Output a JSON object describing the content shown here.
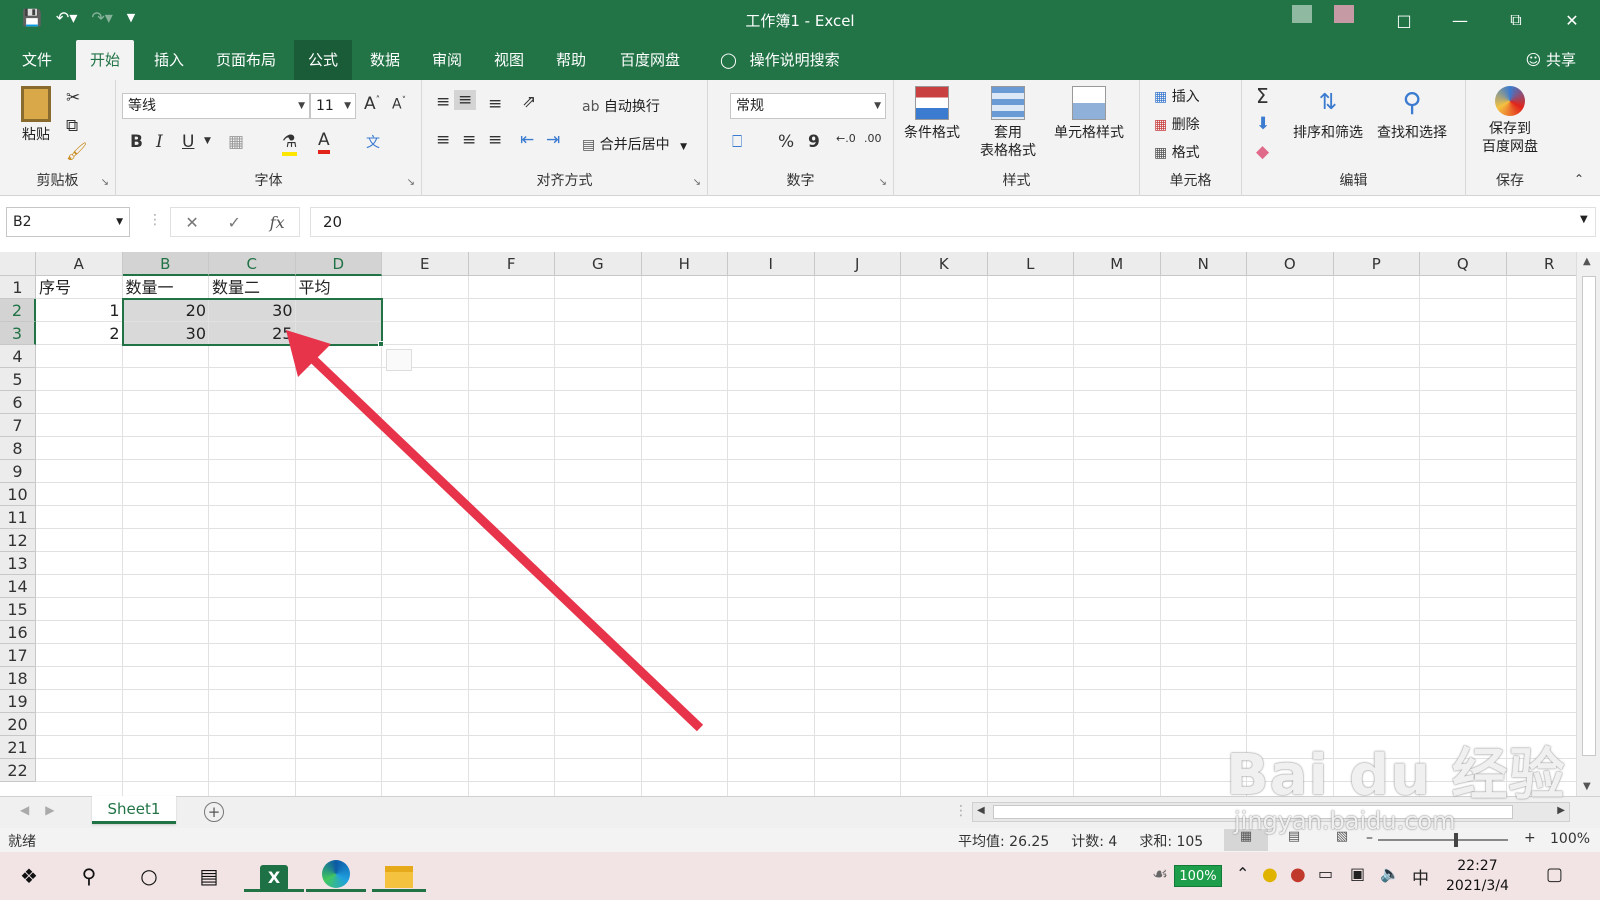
{
  "titlebar": {
    "title": "工作簿1  -  Excel",
    "qat_icons": [
      "save-icon",
      "undo-icon",
      "redo-icon",
      "customize-icon"
    ],
    "window_controls": [
      "ribbon-display-icon",
      "minimize-icon",
      "restore-icon",
      "close-icon"
    ],
    "colors": {
      "bar": "#227447"
    }
  },
  "tabs": {
    "items": [
      "文件",
      "开始",
      "插入",
      "页面布局",
      "公式",
      "数据",
      "审阅",
      "视图",
      "帮助",
      "百度网盘"
    ],
    "active": "开始",
    "tell_me": "操作说明搜索",
    "share": "共享"
  },
  "ribbon": {
    "clipboard": {
      "paste": "粘贴",
      "label": "剪贴板"
    },
    "font": {
      "name": "等线",
      "size": "11",
      "label": "字体",
      "bold": "B",
      "italic": "I",
      "underline": "U"
    },
    "alignment": {
      "wrap": "自动换行",
      "merge": "合并后居中",
      "label": "对齐方式"
    },
    "number": {
      "format": "常规",
      "percent": "%",
      "comma": "9",
      "label": "数字"
    },
    "styles": {
      "conditional": "条件格式",
      "table1": "套用",
      "table2": "表格格式",
      "cell_styles": "单元格样式",
      "label": "样式"
    },
    "cells": {
      "insert": "插入",
      "delete": "删除",
      "format": "格式",
      "label": "单元格"
    },
    "editing": {
      "sort": "排序和筛选",
      "find": "查找和选择",
      "label": "编辑"
    },
    "save": {
      "line1": "保存到",
      "line2": "百度网盘",
      "label": "保存"
    }
  },
  "formula_bar": {
    "name_box": "B2",
    "fx": "fx",
    "value": "20"
  },
  "grid": {
    "columns": [
      "A",
      "B",
      "C",
      "D",
      "E",
      "F",
      "G",
      "H",
      "I",
      "J",
      "K",
      "L",
      "M",
      "N",
      "O",
      "P",
      "Q",
      "R"
    ],
    "rows": [
      "1",
      "2",
      "3",
      "4",
      "5",
      "6",
      "7",
      "8",
      "9",
      "10",
      "11",
      "12",
      "13",
      "14",
      "15",
      "16",
      "17",
      "18",
      "19",
      "20",
      "21",
      "22"
    ],
    "cells": {
      "A1": "序号",
      "B1": "数量一",
      "C1": "数量二",
      "D1": "平均",
      "A2": "1",
      "B2": "20",
      "C2": "30",
      "A3": "2",
      "B3": "30",
      "C3": "25"
    },
    "selection": "B2:D3"
  },
  "sheets": {
    "tabs": [
      "Sheet1"
    ],
    "active": "Sheet1"
  },
  "status": {
    "ready": "就绪",
    "average": "平均值: 26.25",
    "count": "计数: 4",
    "sum": "求和: 105",
    "zoom": "100%"
  },
  "taskbar": {
    "battery": "100%",
    "ime": "中",
    "time": "22:27",
    "date": "2021/3/4"
  },
  "watermark": {
    "line1": "Bai du 经验",
    "line2": "jingyan.baidu.com"
  },
  "annotation": {
    "color": "#e8344a"
  }
}
